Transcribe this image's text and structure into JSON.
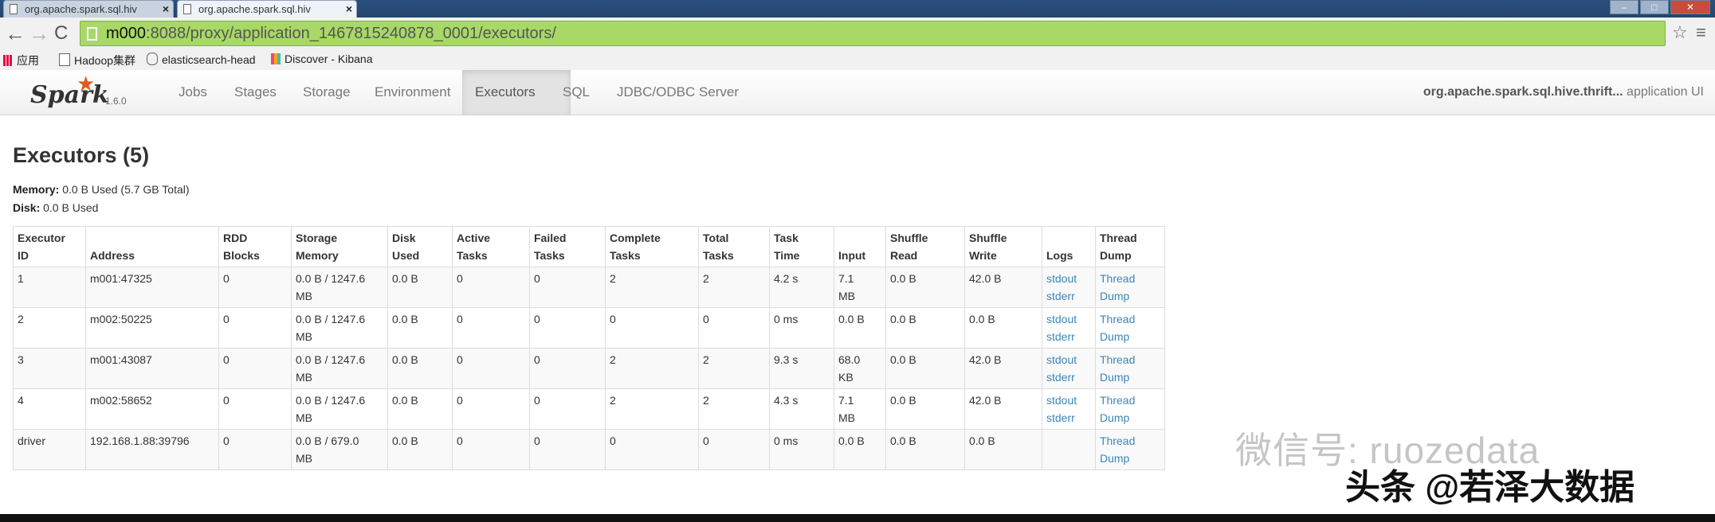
{
  "browser": {
    "tabs": [
      {
        "title": "org.apache.spark.sql.hiv",
        "active": false
      },
      {
        "title": "org.apache.spark.sql.hiv",
        "active": true
      }
    ],
    "url_host": "m000",
    "url_rest": ":8088/proxy/application_1467815240878_0001/executors/",
    "bookmarks": [
      "应用",
      "Hadoop集群",
      "elasticsearch-head",
      "Discover - Kibana"
    ]
  },
  "spark_nav": {
    "logo_text": "Spark",
    "version": "1.6.0",
    "tabs": [
      "Jobs",
      "Stages",
      "Storage",
      "Environment",
      "Executors",
      "SQL",
      "JDBC/ODBC Server"
    ],
    "active_tab": "Executors",
    "app_name_bold": "org.apache.spark.sql.hive.thrift...",
    "app_name_suffix": " application UI"
  },
  "page": {
    "title": "Executors (5)",
    "memory_label": "Memory:",
    "memory_value": " 0.0 B Used (5.7 GB Total)",
    "disk_label": "Disk:",
    "disk_value": " 0.0 B Used"
  },
  "table": {
    "headers": [
      [
        "Executor",
        "ID"
      ],
      [
        "",
        "Address"
      ],
      [
        "RDD",
        "Blocks"
      ],
      [
        "Storage",
        "Memory"
      ],
      [
        "Disk",
        "Used"
      ],
      [
        "Active",
        "Tasks"
      ],
      [
        "Failed",
        "Tasks"
      ],
      [
        "Complete",
        "Tasks"
      ],
      [
        "Total",
        "Tasks"
      ],
      [
        "Task",
        "Time"
      ],
      [
        "",
        "Input"
      ],
      [
        "Shuffle",
        "Read"
      ],
      [
        "Shuffle",
        "Write"
      ],
      [
        "",
        "Logs"
      ],
      [
        "Thread",
        "Dump"
      ]
    ],
    "rows": [
      {
        "id": "1",
        "address": "m001:47325",
        "rdd_blocks": "0",
        "storage_memory": [
          "0.0 B / 1247.6",
          "MB"
        ],
        "disk_used": "0.0 B",
        "active": "0",
        "failed": "0",
        "complete": "2",
        "total": "2",
        "task_time": "4.2 s",
        "input": [
          "7.1",
          "MB"
        ],
        "shuffle_read": "0.0 B",
        "shuffle_write": "42.0 B",
        "logs": [
          "stdout",
          "stderr"
        ],
        "thread_dump": [
          "Thread",
          "Dump"
        ]
      },
      {
        "id": "2",
        "address": "m002:50225",
        "rdd_blocks": "0",
        "storage_memory": [
          "0.0 B / 1247.6",
          "MB"
        ],
        "disk_used": "0.0 B",
        "active": "0",
        "failed": "0",
        "complete": "0",
        "total": "0",
        "task_time": "0 ms",
        "input": [
          "0.0 B",
          ""
        ],
        "shuffle_read": "0.0 B",
        "shuffle_write": "0.0 B",
        "logs": [
          "stdout",
          "stderr"
        ],
        "thread_dump": [
          "Thread",
          "Dump"
        ]
      },
      {
        "id": "3",
        "address": "m001:43087",
        "rdd_blocks": "0",
        "storage_memory": [
          "0.0 B / 1247.6",
          "MB"
        ],
        "disk_used": "0.0 B",
        "active": "0",
        "failed": "0",
        "complete": "2",
        "total": "2",
        "task_time": "9.3 s",
        "input": [
          "68.0",
          "KB"
        ],
        "shuffle_read": "0.0 B",
        "shuffle_write": "42.0 B",
        "logs": [
          "stdout",
          "stderr"
        ],
        "thread_dump": [
          "Thread",
          "Dump"
        ]
      },
      {
        "id": "4",
        "address": "m002:58652",
        "rdd_blocks": "0",
        "storage_memory": [
          "0.0 B / 1247.6",
          "MB"
        ],
        "disk_used": "0.0 B",
        "active": "0",
        "failed": "0",
        "complete": "2",
        "total": "2",
        "task_time": "4.3 s",
        "input": [
          "7.1",
          "MB"
        ],
        "shuffle_read": "0.0 B",
        "shuffle_write": "42.0 B",
        "logs": [
          "stdout",
          "stderr"
        ],
        "thread_dump": [
          "Thread",
          "Dump"
        ]
      },
      {
        "id": "driver",
        "address": "192.168.1.88:39796",
        "rdd_blocks": "0",
        "storage_memory": [
          "0.0 B / 679.0",
          "MB"
        ],
        "disk_used": "0.0 B",
        "active": "0",
        "failed": "0",
        "complete": "0",
        "total": "0",
        "task_time": "0 ms",
        "input": [
          "0.0 B",
          ""
        ],
        "shuffle_read": "0.0 B",
        "shuffle_write": "0.0 B",
        "logs": [],
        "thread_dump": [
          "Thread",
          "Dump"
        ]
      }
    ]
  },
  "watermarks": {
    "wechat": "微信号: ruozedata",
    "toutiao": "头条 @若泽大数据"
  },
  "colors": {
    "spark_orange": "#e25a1c",
    "link_blue": "#3b86b8",
    "omnibox_green": "#a8d866"
  }
}
